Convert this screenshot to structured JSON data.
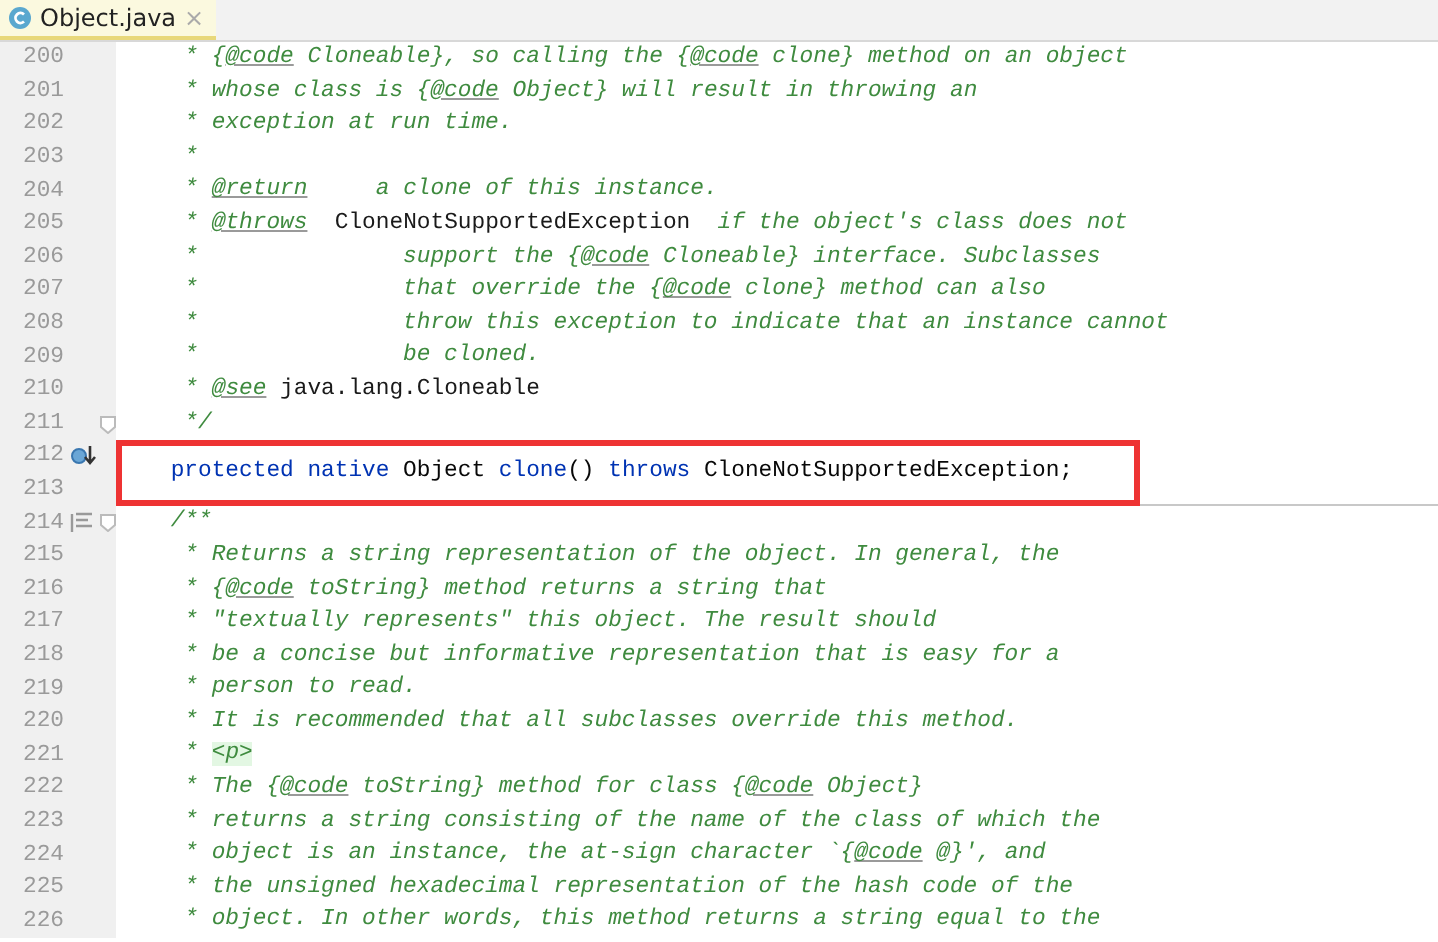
{
  "tabs": [
    {
      "label": "Object.java",
      "selected": true,
      "close": "×"
    }
  ],
  "lines": [
    {
      "number": "200",
      "tokens": [
        {
          "kind": "doc",
          "text": "     * {"
        },
        {
          "kind": "tag",
          "text": "@code"
        },
        {
          "kind": "doc",
          "text": " Cloneable}, so calling the {"
        },
        {
          "kind": "tag",
          "text": "@code"
        },
        {
          "kind": "doc",
          "text": " clone} method on an object"
        }
      ]
    },
    {
      "number": "201",
      "tokens": [
        {
          "kind": "doc",
          "text": "     * whose class is {"
        },
        {
          "kind": "tag",
          "text": "@code"
        },
        {
          "kind": "doc",
          "text": " Object} will result in throwing an"
        }
      ]
    },
    {
      "number": "202",
      "tokens": [
        {
          "kind": "doc",
          "text": "     * exception at run time."
        }
      ]
    },
    {
      "number": "203",
      "tokens": [
        {
          "kind": "doc",
          "text": "     *"
        }
      ]
    },
    {
      "number": "204",
      "tokens": [
        {
          "kind": "doc",
          "text": "     * "
        },
        {
          "kind": "tag",
          "text": "@return"
        },
        {
          "kind": "doc",
          "text": "     a clone of this instance."
        }
      ]
    },
    {
      "number": "205",
      "tokens": [
        {
          "kind": "doc",
          "text": "     * "
        },
        {
          "kind": "tag",
          "text": "@throws"
        },
        {
          "kind": "ref",
          "text": "  CloneNotSupportedException"
        },
        {
          "kind": "doc",
          "text": "  if the object's class does not"
        }
      ]
    },
    {
      "number": "206",
      "tokens": [
        {
          "kind": "doc",
          "text": "     *               support the {"
        },
        {
          "kind": "tag",
          "text": "@code"
        },
        {
          "kind": "doc",
          "text": " Cloneable} interface. Subclasses"
        }
      ]
    },
    {
      "number": "207",
      "tokens": [
        {
          "kind": "doc",
          "text": "     *               that override the {"
        },
        {
          "kind": "tag",
          "text": "@code"
        },
        {
          "kind": "doc",
          "text": " clone} method can also"
        }
      ]
    },
    {
      "number": "208",
      "tokens": [
        {
          "kind": "doc",
          "text": "     *               throw this exception to indicate that an instance cannot"
        }
      ]
    },
    {
      "number": "209",
      "tokens": [
        {
          "kind": "doc",
          "text": "     *               be cloned."
        }
      ]
    },
    {
      "number": "210",
      "tokens": [
        {
          "kind": "doc",
          "text": "     * "
        },
        {
          "kind": "tag",
          "text": "@see"
        },
        {
          "kind": "ref",
          "text": " java.lang.Cloneable"
        }
      ]
    },
    {
      "number": "211",
      "fold": true,
      "tokens": [
        {
          "kind": "doc",
          "text": "     */"
        }
      ]
    },
    {
      "number": "212",
      "implemented": true,
      "highlighted": true,
      "tokens": [
        {
          "kind": "keyword",
          "text": "    protected native"
        },
        {
          "kind": "plain",
          "text": " Object "
        },
        {
          "kind": "keyword",
          "text": "clone"
        },
        {
          "kind": "plain",
          "text": "() "
        },
        {
          "kind": "keyword",
          "text": "throws"
        },
        {
          "kind": "plain",
          "text": " CloneNotSupportedException;"
        }
      ]
    },
    {
      "number": "213",
      "highlighted": true,
      "separator": true
    },
    {
      "number": "214",
      "rendered_doc": true,
      "fold": true,
      "tokens": [
        {
          "kind": "doc",
          "text": "    /**"
        }
      ]
    },
    {
      "number": "215",
      "tokens": [
        {
          "kind": "doc",
          "text": "     * Returns a string representation of the object. In general, the"
        }
      ]
    },
    {
      "number": "216",
      "tokens": [
        {
          "kind": "doc",
          "text": "     * {"
        },
        {
          "kind": "tag",
          "text": "@code"
        },
        {
          "kind": "doc",
          "text": " toString} method returns a string that"
        }
      ]
    },
    {
      "number": "217",
      "tokens": [
        {
          "kind": "doc",
          "text": "     * \"textually represents\" this object. The result should"
        }
      ]
    },
    {
      "number": "218",
      "tokens": [
        {
          "kind": "doc",
          "text": "     * be a concise but informative representation that is easy for a"
        }
      ]
    },
    {
      "number": "219",
      "tokens": [
        {
          "kind": "doc",
          "text": "     * person to read."
        }
      ]
    },
    {
      "number": "220",
      "tokens": [
        {
          "kind": "doc",
          "text": "     * It is recommended that all subclasses override this method."
        }
      ]
    },
    {
      "number": "221",
      "tokens": [
        {
          "kind": "doc",
          "text": "     * "
        },
        {
          "kind": "html",
          "text": "<p>"
        }
      ]
    },
    {
      "number": "222",
      "tokens": [
        {
          "kind": "doc",
          "text": "     * The {"
        },
        {
          "kind": "tag",
          "text": "@code"
        },
        {
          "kind": "doc",
          "text": " toString} method for class {"
        },
        {
          "kind": "tag",
          "text": "@code"
        },
        {
          "kind": "doc",
          "text": " Object}"
        }
      ]
    },
    {
      "number": "223",
      "tokens": [
        {
          "kind": "doc",
          "text": "     * returns a string consisting of the name of the class of which the"
        }
      ]
    },
    {
      "number": "224",
      "tokens": [
        {
          "kind": "doc",
          "text": "     * object is an instance, the at-sign character `{"
        },
        {
          "kind": "tag",
          "text": "@code"
        },
        {
          "kind": "doc",
          "text": " @}', and"
        }
      ]
    },
    {
      "number": "225",
      "tokens": [
        {
          "kind": "doc",
          "text": "     * the unsigned hexadecimal representation of the hash code of the"
        }
      ]
    },
    {
      "number": "226",
      "tokens": [
        {
          "kind": "doc",
          "text": "     * object. In other words, this method returns a string equal to the"
        }
      ]
    }
  ]
}
